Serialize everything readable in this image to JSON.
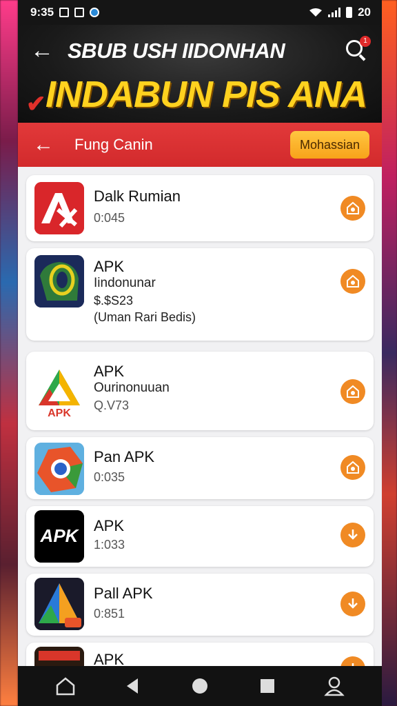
{
  "status_bar": {
    "time": "9:35",
    "right_text": "20"
  },
  "banner": {
    "title": "SBUB USH IIDONHAN",
    "headline": "INDABUN PIS ANA",
    "search_badge": "1"
  },
  "toolbar": {
    "title": "Fung Canin",
    "button_label": "Mohassian"
  },
  "apps": [
    {
      "name": "Dalk Rumian",
      "sub": "",
      "meta": "0:045",
      "extra": "",
      "icon": "ax-logo-icon",
      "action_icon": "install-icon"
    },
    {
      "name": "APK",
      "sub": "Iindonunar",
      "meta": "$.$S23",
      "extra": "(Uman Rari Bedis)",
      "icon": "eye-logo-icon",
      "action_icon": "install-icon"
    },
    {
      "name": "APK",
      "sub": "Ourinonuuan",
      "meta": "Q.V73",
      "extra": "",
      "icon": "apk-triangle-icon",
      "action_icon": "install-icon"
    },
    {
      "name": "Pan APK",
      "sub": "",
      "meta": "0:035",
      "extra": "",
      "icon": "circle-logo-icon",
      "action_icon": "install-icon"
    },
    {
      "name": "APK",
      "sub": "",
      "meta": "1:033",
      "extra": "",
      "icon": "apk-text-icon",
      "action_icon": "download-icon"
    },
    {
      "name": "Pall APK",
      "sub": "",
      "meta": "0:851",
      "extra": "",
      "icon": "apk-gradient-icon",
      "action_icon": "download-icon"
    },
    {
      "name": "APK",
      "sub": "",
      "meta": "",
      "extra": "",
      "icon": "apk-dark-icon",
      "action_icon": "download-icon"
    }
  ],
  "colors": {
    "toolbar_red": "#d22a2c",
    "accent_orange": "#f08a24",
    "headline_yellow": "#ffd21f"
  }
}
